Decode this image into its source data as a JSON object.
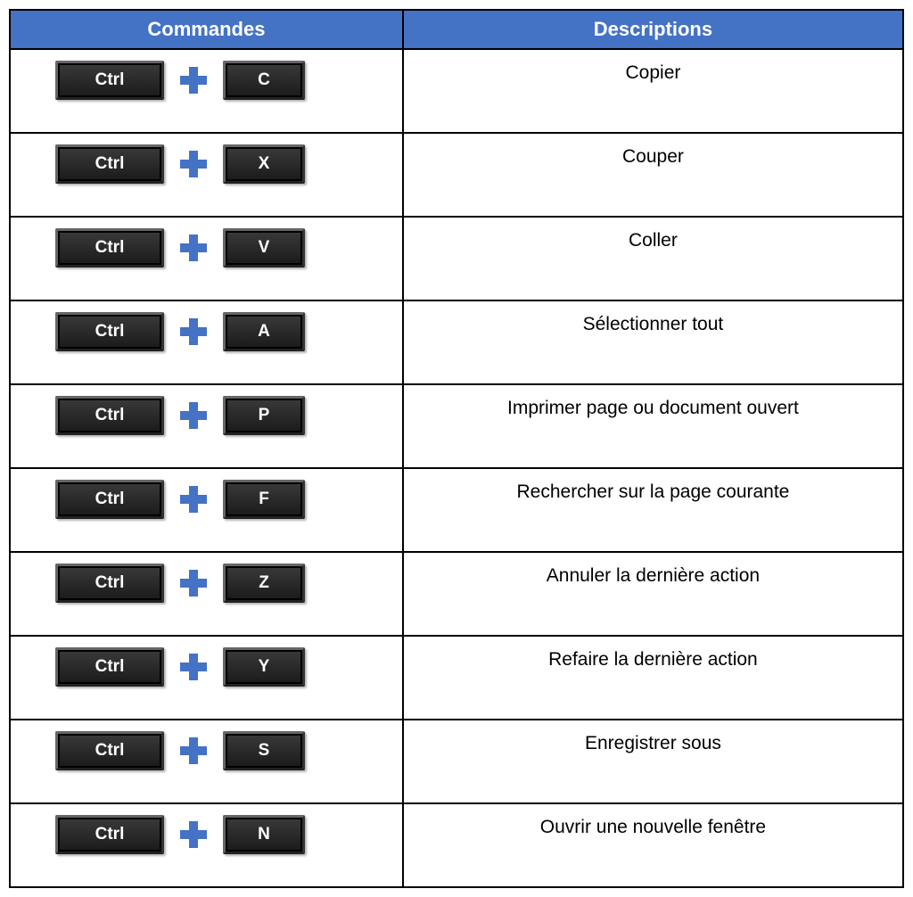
{
  "headers": {
    "commands": "Commandes",
    "descriptions": "Descriptions"
  },
  "rows": [
    {
      "key1": "Ctrl",
      "key2": "C",
      "desc": "Copier"
    },
    {
      "key1": "Ctrl",
      "key2": "X",
      "desc": "Couper"
    },
    {
      "key1": "Ctrl",
      "key2": "V",
      "desc": "Coller"
    },
    {
      "key1": "Ctrl",
      "key2": "A",
      "desc": "Sélectionner tout"
    },
    {
      "key1": "Ctrl",
      "key2": "P",
      "desc": "Imprimer page ou document ouvert"
    },
    {
      "key1": "Ctrl",
      "key2": "F",
      "desc": "Rechercher sur la page courante"
    },
    {
      "key1": "Ctrl",
      "key2": "Z",
      "desc": "Annuler la dernière action"
    },
    {
      "key1": "Ctrl",
      "key2": "Y",
      "desc": "Refaire la dernière action"
    },
    {
      "key1": "Ctrl",
      "key2": "S",
      "desc": "Enregistrer sous"
    },
    {
      "key1": "Ctrl",
      "key2": "N",
      "desc": "Ouvrir une nouvelle fenêtre"
    }
  ]
}
